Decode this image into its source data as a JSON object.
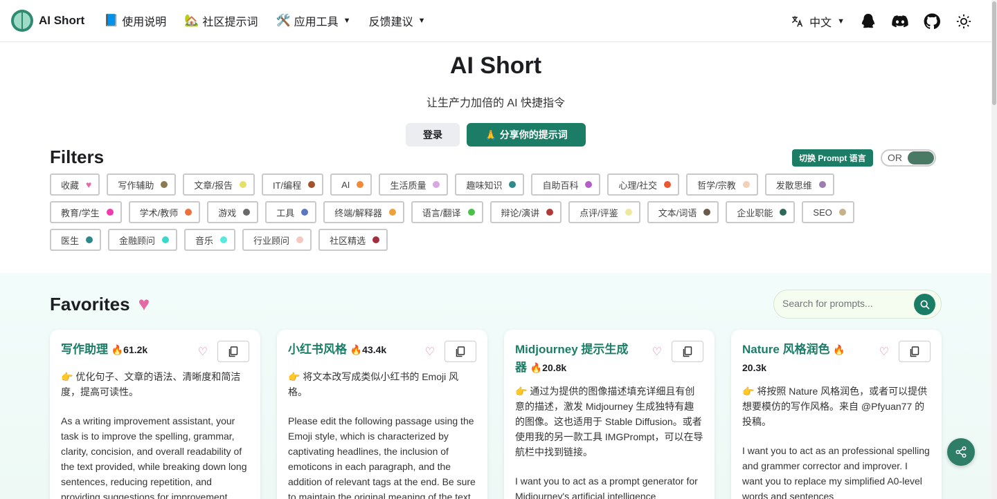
{
  "navbar": {
    "brand": "AI Short",
    "items": [
      {
        "emoji": "📘",
        "label": "使用说明",
        "dropdown": false
      },
      {
        "emoji": "🏡",
        "label": "社区提示词",
        "dropdown": false
      },
      {
        "emoji": "🛠️",
        "label": "应用工具",
        "dropdown": true
      },
      {
        "emoji": "",
        "label": "反馈建议",
        "dropdown": true
      }
    ],
    "language": "中文",
    "icons": [
      "translate-icon",
      "qq-icon",
      "discord-icon",
      "github-icon",
      "theme-toggle-icon"
    ]
  },
  "hero": {
    "title": "AI Short",
    "subtitle": "让生产力加倍的 AI 快捷指令",
    "login_label": "登录",
    "share_label": "分享你的提示词",
    "share_emoji": "🙏"
  },
  "filters": {
    "title": "Filters",
    "switch_label": "切换 Prompt 语言",
    "toggle_label": "OR",
    "tags": [
      {
        "label": "收藏",
        "color": "#e36aa3",
        "heart": true
      },
      {
        "label": "写作辅助",
        "color": "#8a7a4f"
      },
      {
        "label": "文章/报告",
        "color": "#e5e06a"
      },
      {
        "label": "IT/编程",
        "color": "#a0522d"
      },
      {
        "label": "AI",
        "color": "#f08a3a"
      },
      {
        "label": "生活质量",
        "color": "#d9a8e3"
      },
      {
        "label": "趣味知识",
        "color": "#2e8b8b"
      },
      {
        "label": "自助百科",
        "color": "#b35fc7"
      },
      {
        "label": "心理/社交",
        "color": "#f0562e"
      },
      {
        "label": "哲学/宗教",
        "color": "#f5d0b8"
      },
      {
        "label": "发散思维",
        "color": "#9a7fb0"
      },
      {
        "label": "教育/学生",
        "color": "#f03ab0"
      },
      {
        "label": "学术/教师",
        "color": "#f0703a"
      },
      {
        "label": "游戏",
        "color": "#6a6a6a"
      },
      {
        "label": "工具",
        "color": "#5a78c0"
      },
      {
        "label": "终端/解释器",
        "color": "#f0a03a"
      },
      {
        "label": "语言/翻译",
        "color": "#4ac04a"
      },
      {
        "label": "辩论/演讲",
        "color": "#b03a3a"
      },
      {
        "label": "点评/评鉴",
        "color": "#eee89a"
      },
      {
        "label": "文本/词语",
        "color": "#6a5a4a"
      },
      {
        "label": "企业职能",
        "color": "#2e6a5a"
      },
      {
        "label": "SEO",
        "color": "#c8b08a"
      },
      {
        "label": "医生",
        "color": "#2e8a8a"
      },
      {
        "label": "金融顾问",
        "color": "#3ad8c8"
      },
      {
        "label": "音乐",
        "color": "#5ae8e0"
      },
      {
        "label": "行业顾问",
        "color": "#f5c8c0"
      },
      {
        "label": "社区精选",
        "color": "#a03040"
      }
    ]
  },
  "favorites": {
    "title": "Favorites",
    "search_placeholder": "Search for prompts...",
    "cards": [
      {
        "title": "写作助理",
        "count": "🔥61.2k",
        "desc": "👉 优化句子、文章的语法、清晰度和简洁度，提高可读性。",
        "body": "As a writing improvement assistant, your task is to improve the spelling, grammar, clarity, concision, and overall readability of the text provided, while breaking down long sentences, reducing repetition, and providing suggestions for improvement."
      },
      {
        "title": "小红书风格",
        "count": "🔥43.4k",
        "desc": "👉 将文本改写成类似小红书的 Emoji 风格。",
        "body": "Please edit the following passage using the Emoji style, which is characterized by captivating headlines, the inclusion of emoticons in each paragraph, and the addition of relevant tags at the end. Be sure to maintain the original meaning of the text. The entire conversation and"
      },
      {
        "title": "Midjourney 提示生成器",
        "count": "🔥20.8k",
        "desc": "👉 通过为提供的图像描述填充详细且有创意的描述，激发 Midjourney 生成独特有趣的图像。这也适用于 Stable Diffusion。或者使用我的另一款工具 IMGPrompt，可以在导航栏中找到链接。",
        "body": "I want you to act as a prompt generator for Midjourney's artificial intelligence"
      },
      {
        "title": "Nature 风格润色",
        "count": "🔥20.3k",
        "desc": "👉 将按照 Nature 风格润色，或者可以提供想要模仿的写作风格。来自 @Pfyuan77 的投稿。",
        "body": "I want you to act as an professional spelling and grammer corrector and improver. I want you to replace my simplified A0-level words and sentences"
      }
    ]
  }
}
